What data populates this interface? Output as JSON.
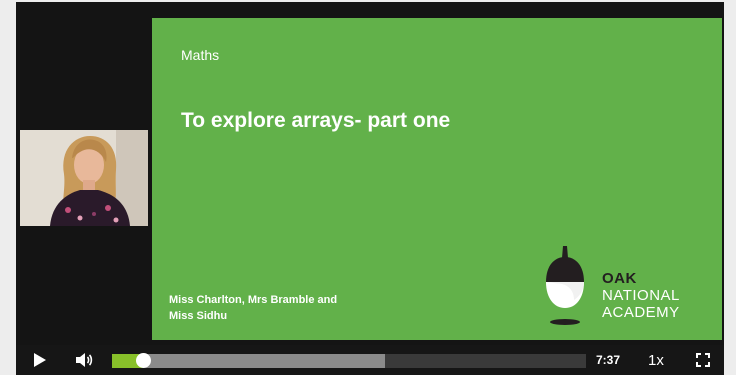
{
  "slide": {
    "subject": "Maths",
    "title": "To explore arrays- part one",
    "teachers_line1": "Miss Charlton, Mrs Bramble and",
    "teachers_line2": "Miss Sidhu",
    "background": "#62b14a"
  },
  "logo": {
    "line1": "OAK",
    "line2": "NATIONAL",
    "line3": "ACADEMY"
  },
  "controls": {
    "play_icon": "play-icon",
    "volume_icon": "volume-icon",
    "fullscreen_icon": "fullscreen-icon",
    "time": "7:37",
    "speed": "1x",
    "progress_played_fraction": 0.065,
    "progress_buffered_fraction": 0.575,
    "accent_color": "#88c02a"
  }
}
